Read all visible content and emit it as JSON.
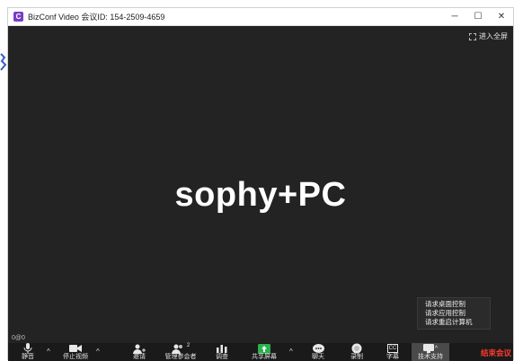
{
  "window": {
    "title": "BizConf Video 会议ID: 154-2509-4659",
    "logo_letter": "C",
    "controls": {
      "minimize": "─",
      "maximize": "☐",
      "close": "✕"
    }
  },
  "video": {
    "fullscreen_label": "进入全屏",
    "participant_name": "sophy+PC",
    "stats_label": "0@0"
  },
  "popup_menu": {
    "items": [
      "请求桌面控制",
      "请求应用控制",
      "请求重启计算机"
    ]
  },
  "toolbar": {
    "mute": "静音",
    "stop_video": "停止视频",
    "invite": "邀请",
    "manage_participants": "管理参会者",
    "participant_count": "2",
    "poll": "调查",
    "share_screen": "共享屏幕",
    "chat": "聊天",
    "record": "录制",
    "captions": "字幕",
    "captions_icon": "CC",
    "tech_support": "技术支持",
    "end_meeting": "结束会议",
    "caret": "^"
  },
  "colors": {
    "accent_green": "#2bb24c",
    "end_red": "#ff3b30",
    "logo_purple": "#7a3cc8"
  }
}
